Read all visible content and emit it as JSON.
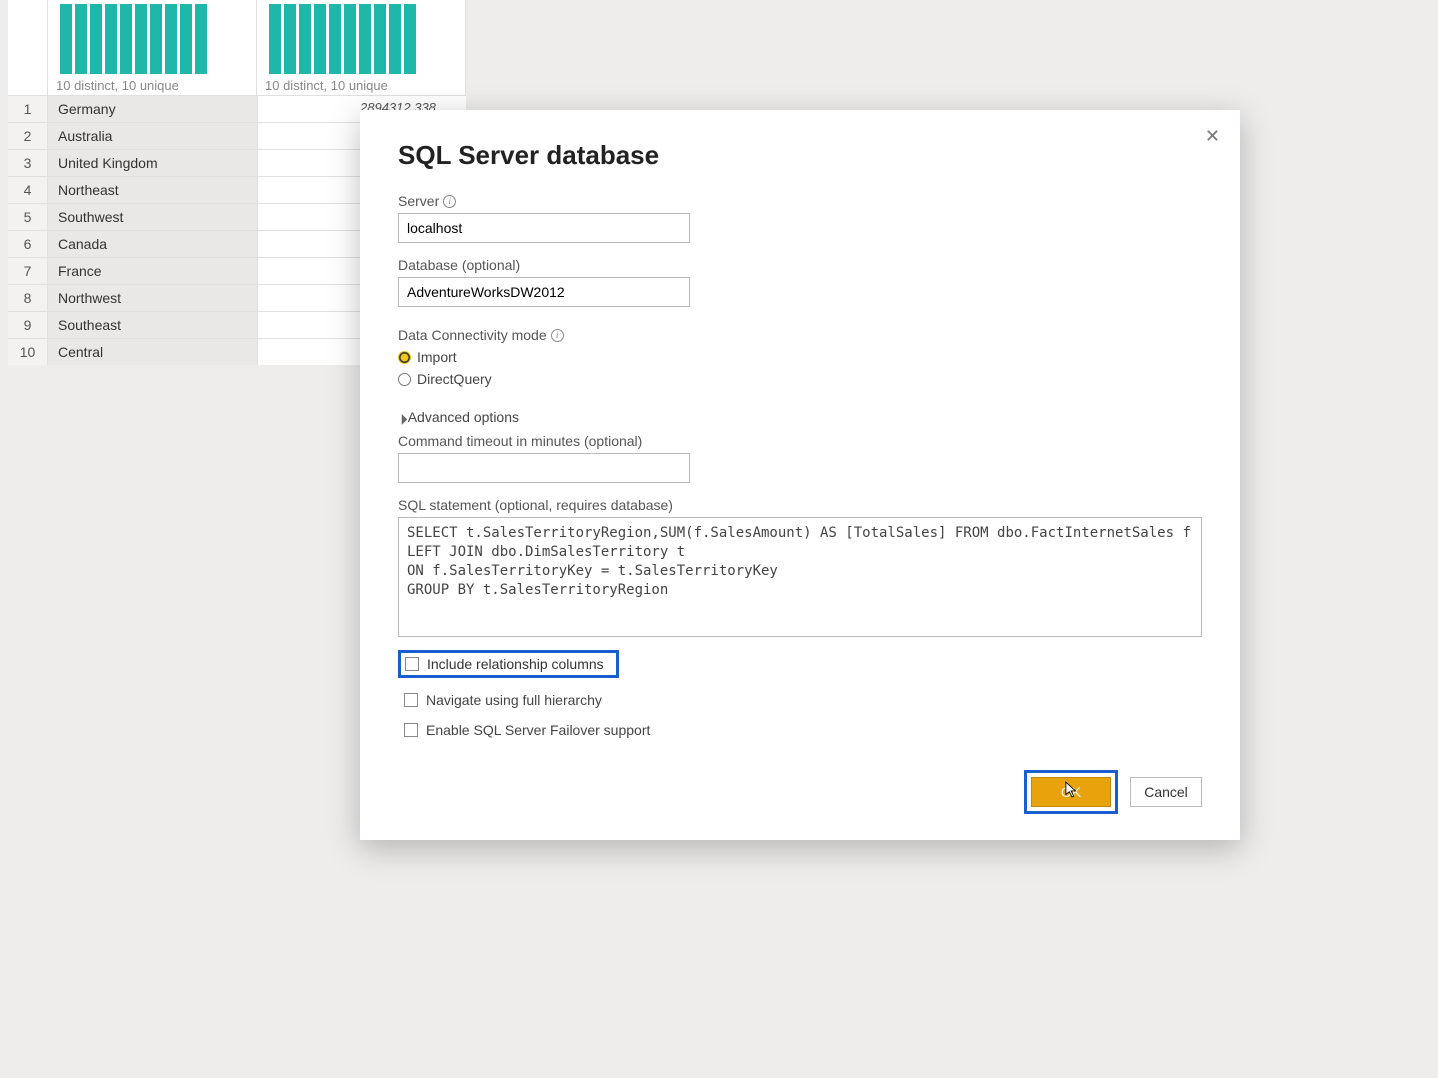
{
  "columns": {
    "distinct_a": "10 distinct, 10 unique",
    "distinct_b": "10 distinct, 10 unique"
  },
  "rows": [
    {
      "n": "1",
      "a": "Germany",
      "b": ""
    },
    {
      "n": "2",
      "a": "Australia",
      "b": ""
    },
    {
      "n": "3",
      "a": "United Kingdom",
      "b": ""
    },
    {
      "n": "4",
      "a": "Northeast",
      "b": ""
    },
    {
      "n": "5",
      "a": "Southwest",
      "b": ""
    },
    {
      "n": "6",
      "a": "Canada",
      "b": ""
    },
    {
      "n": "7",
      "a": "France",
      "b": ""
    },
    {
      "n": "8",
      "a": "Northwest",
      "b": ""
    },
    {
      "n": "9",
      "a": "Southeast",
      "b": ""
    },
    {
      "n": "10",
      "a": "Central",
      "b": ""
    }
  ],
  "partial_value": "2894312.338",
  "dialog": {
    "title": "SQL Server database",
    "server_label": "Server",
    "server_value": "localhost",
    "database_label": "Database (optional)",
    "database_value": "AdventureWorksDW2012",
    "connectivity_label": "Data Connectivity mode",
    "radio_import": "Import",
    "radio_direct": "DirectQuery",
    "advanced_label": "Advanced options",
    "timeout_label": "Command timeout in minutes (optional)",
    "timeout_value": "",
    "sql_label": "SQL statement (optional, requires database)",
    "sql_value": "SELECT t.SalesTerritoryRegion,SUM(f.SalesAmount) AS [TotalSales] FROM dbo.FactInternetSales f \nLEFT JOIN dbo.DimSalesTerritory t\nON f.SalesTerritoryKey = t.SalesTerritoryKey\nGROUP BY t.SalesTerritoryRegion",
    "chk_relationship": "Include relationship columns",
    "chk_hierarchy": "Navigate using full hierarchy",
    "chk_failover": "Enable SQL Server Failover support",
    "ok": "OK",
    "cancel": "Cancel"
  }
}
